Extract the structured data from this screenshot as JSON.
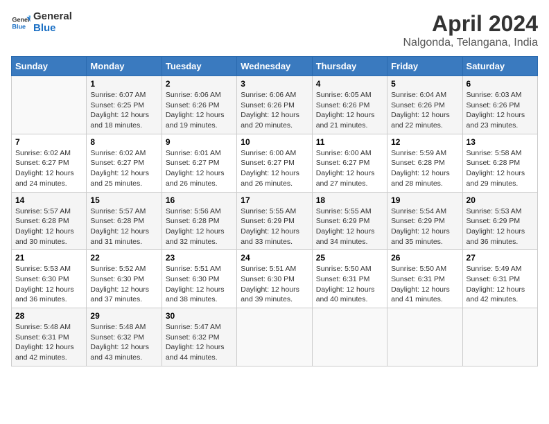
{
  "header": {
    "logo_general": "General",
    "logo_blue": "Blue",
    "title": "April 2024",
    "location": "Nalgonda, Telangana, India"
  },
  "columns": [
    "Sunday",
    "Monday",
    "Tuesday",
    "Wednesday",
    "Thursday",
    "Friday",
    "Saturday"
  ],
  "weeks": [
    [
      {
        "day": "",
        "info": ""
      },
      {
        "day": "1",
        "info": "Sunrise: 6:07 AM\nSunset: 6:25 PM\nDaylight: 12 hours\nand 18 minutes."
      },
      {
        "day": "2",
        "info": "Sunrise: 6:06 AM\nSunset: 6:26 PM\nDaylight: 12 hours\nand 19 minutes."
      },
      {
        "day": "3",
        "info": "Sunrise: 6:06 AM\nSunset: 6:26 PM\nDaylight: 12 hours\nand 20 minutes."
      },
      {
        "day": "4",
        "info": "Sunrise: 6:05 AM\nSunset: 6:26 PM\nDaylight: 12 hours\nand 21 minutes."
      },
      {
        "day": "5",
        "info": "Sunrise: 6:04 AM\nSunset: 6:26 PM\nDaylight: 12 hours\nand 22 minutes."
      },
      {
        "day": "6",
        "info": "Sunrise: 6:03 AM\nSunset: 6:26 PM\nDaylight: 12 hours\nand 23 minutes."
      }
    ],
    [
      {
        "day": "7",
        "info": "Sunrise: 6:02 AM\nSunset: 6:27 PM\nDaylight: 12 hours\nand 24 minutes."
      },
      {
        "day": "8",
        "info": "Sunrise: 6:02 AM\nSunset: 6:27 PM\nDaylight: 12 hours\nand 25 minutes."
      },
      {
        "day": "9",
        "info": "Sunrise: 6:01 AM\nSunset: 6:27 PM\nDaylight: 12 hours\nand 26 minutes."
      },
      {
        "day": "10",
        "info": "Sunrise: 6:00 AM\nSunset: 6:27 PM\nDaylight: 12 hours\nand 26 minutes."
      },
      {
        "day": "11",
        "info": "Sunrise: 6:00 AM\nSunset: 6:27 PM\nDaylight: 12 hours\nand 27 minutes."
      },
      {
        "day": "12",
        "info": "Sunrise: 5:59 AM\nSunset: 6:28 PM\nDaylight: 12 hours\nand 28 minutes."
      },
      {
        "day": "13",
        "info": "Sunrise: 5:58 AM\nSunset: 6:28 PM\nDaylight: 12 hours\nand 29 minutes."
      }
    ],
    [
      {
        "day": "14",
        "info": "Sunrise: 5:57 AM\nSunset: 6:28 PM\nDaylight: 12 hours\nand 30 minutes."
      },
      {
        "day": "15",
        "info": "Sunrise: 5:57 AM\nSunset: 6:28 PM\nDaylight: 12 hours\nand 31 minutes."
      },
      {
        "day": "16",
        "info": "Sunrise: 5:56 AM\nSunset: 6:28 PM\nDaylight: 12 hours\nand 32 minutes."
      },
      {
        "day": "17",
        "info": "Sunrise: 5:55 AM\nSunset: 6:29 PM\nDaylight: 12 hours\nand 33 minutes."
      },
      {
        "day": "18",
        "info": "Sunrise: 5:55 AM\nSunset: 6:29 PM\nDaylight: 12 hours\nand 34 minutes."
      },
      {
        "day": "19",
        "info": "Sunrise: 5:54 AM\nSunset: 6:29 PM\nDaylight: 12 hours\nand 35 minutes."
      },
      {
        "day": "20",
        "info": "Sunrise: 5:53 AM\nSunset: 6:29 PM\nDaylight: 12 hours\nand 36 minutes."
      }
    ],
    [
      {
        "day": "21",
        "info": "Sunrise: 5:53 AM\nSunset: 6:30 PM\nDaylight: 12 hours\nand 36 minutes."
      },
      {
        "day": "22",
        "info": "Sunrise: 5:52 AM\nSunset: 6:30 PM\nDaylight: 12 hours\nand 37 minutes."
      },
      {
        "day": "23",
        "info": "Sunrise: 5:51 AM\nSunset: 6:30 PM\nDaylight: 12 hours\nand 38 minutes."
      },
      {
        "day": "24",
        "info": "Sunrise: 5:51 AM\nSunset: 6:30 PM\nDaylight: 12 hours\nand 39 minutes."
      },
      {
        "day": "25",
        "info": "Sunrise: 5:50 AM\nSunset: 6:31 PM\nDaylight: 12 hours\nand 40 minutes."
      },
      {
        "day": "26",
        "info": "Sunrise: 5:50 AM\nSunset: 6:31 PM\nDaylight: 12 hours\nand 41 minutes."
      },
      {
        "day": "27",
        "info": "Sunrise: 5:49 AM\nSunset: 6:31 PM\nDaylight: 12 hours\nand 42 minutes."
      }
    ],
    [
      {
        "day": "28",
        "info": "Sunrise: 5:48 AM\nSunset: 6:31 PM\nDaylight: 12 hours\nand 42 minutes."
      },
      {
        "day": "29",
        "info": "Sunrise: 5:48 AM\nSunset: 6:32 PM\nDaylight: 12 hours\nand 43 minutes."
      },
      {
        "day": "30",
        "info": "Sunrise: 5:47 AM\nSunset: 6:32 PM\nDaylight: 12 hours\nand 44 minutes."
      },
      {
        "day": "",
        "info": ""
      },
      {
        "day": "",
        "info": ""
      },
      {
        "day": "",
        "info": ""
      },
      {
        "day": "",
        "info": ""
      }
    ]
  ]
}
